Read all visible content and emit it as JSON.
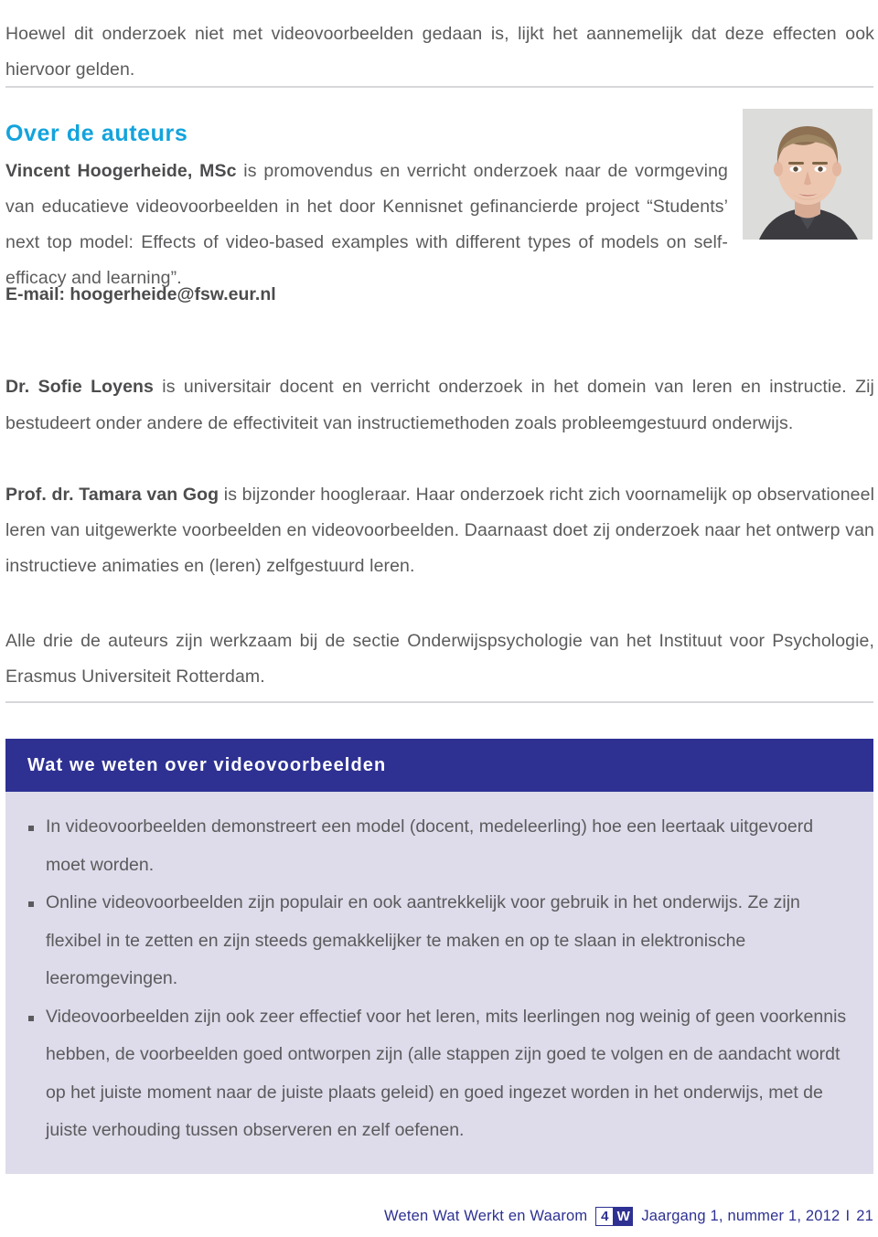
{
  "intro": {
    "text": "Hoewel dit onderzoek niet met videovoorbeelden gedaan is, lijkt het aannemelijk dat deze effecten ook hiervoor gelden."
  },
  "authors_section": {
    "heading": "Over de auteurs",
    "accent_color": "#13a3dc",
    "author1": {
      "name": "Vincent Hoogerheide, MSc",
      "bio": " is promovendus en verricht onderzoek naar de vormgeving van educatieve videovoorbeelden in het door Kennisnet gefinancierde project “Students’ next top model: Effects of video-based examples with different types of models on self-efficacy and learning”.",
      "email_line": "E-mail: hoogerheide@fsw.eur.nl",
      "photo_alt": "portretfoto Vincent Hoogerheide"
    },
    "author2": {
      "name": "Dr. Sofie Loyens",
      "bio": " is universitair docent en verricht onderzoek in het domein van leren en instructie. Zij bestudeert onder andere de effectiviteit van instructiemethoden zoals probleemgestuurd onderwijs."
    },
    "author3": {
      "name": "Prof. dr. Tamara van Gog",
      "bio": " is bijzonder hoogleraar. Haar onderzoek richt zich voornamelijk op observationeel leren van uitgewerkte voorbeelden en videovoorbeelden. Daarnaast doet zij onderzoek naar het ontwerp van instructieve animaties en (leren) zelfgestuurd leren."
    },
    "affiliation": "Alle drie de auteurs zijn werkzaam bij de sectie Onderwijspsychologie van het Instituut voor Psychologie, Erasmus Universiteit Rotterdam."
  },
  "summary_box": {
    "header_title": "Wat we weten over videovoorbeelden",
    "header_color": "#2e3192",
    "body_color": "#dedbea",
    "bullets": [
      "In videovoorbeelden demonstreert een model (docent, medeleerling) hoe een leertaak uitgevoerd moet worden.",
      "Online videovoorbeelden zijn populair en ook aantrekkelijk voor gebruik in het onderwijs. Ze zijn flexibel in te zetten en zijn steeds gemakkelijker te maken en op te slaan in elektronische leeromgevingen.",
      "Videovoorbeelden zijn ook zeer effectief voor het leren, mits leerlingen nog weinig of geen voorkennis hebben, de voorbeelden goed ontworpen zijn (alle stappen zijn goed te volgen en de aandacht wordt op het juiste moment naar de juiste plaats geleid) en goed ingezet worden in het onderwijs, met de juiste verhouding tussen observeren en zelf oefenen."
    ]
  },
  "footer": {
    "journal_name": "Weten Wat Werkt en Waarom",
    "logo_number": "4",
    "logo_letter": "W",
    "issue": "Jaargang 1, nummer 1, 2012",
    "separator": "I",
    "page_number": "21",
    "color": "#2e3192"
  }
}
